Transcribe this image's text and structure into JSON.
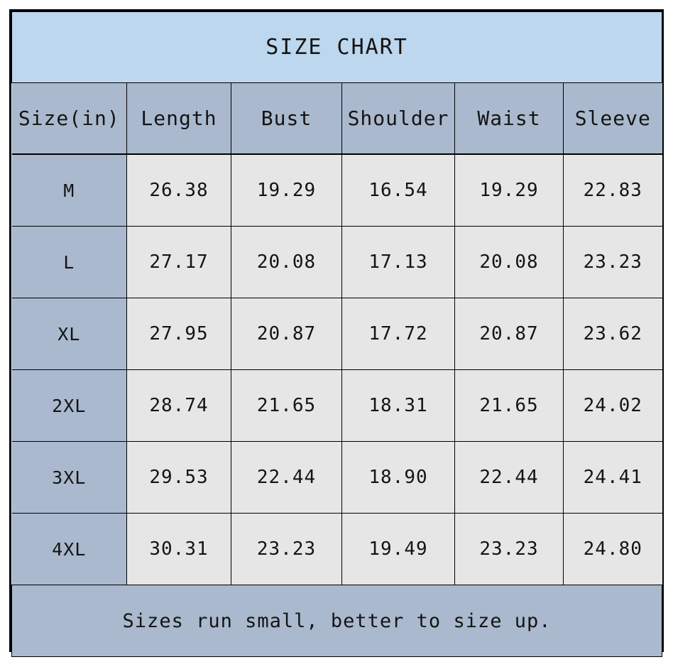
{
  "title": "SIZE CHART",
  "footer_note": "Sizes run small, better to size up.",
  "colors": {
    "title_background": "#bdd7ee",
    "header_background": "#aab9ce",
    "size_column_background": "#aab9ce",
    "data_cell_background": "#e6e6e6",
    "footer_background": "#aab9ce",
    "border": "#000000",
    "text": "#141414"
  },
  "chart_data": {
    "type": "table",
    "title": "SIZE CHART",
    "unit": "in",
    "columns": [
      "Size(in)",
      "Length",
      "Bust",
      "Shoulder",
      "Waist",
      "Sleeve"
    ],
    "rows": [
      {
        "size": "M",
        "length": "26.38",
        "bust": "19.29",
        "shoulder": "16.54",
        "waist": "19.29",
        "sleeve": "22.83"
      },
      {
        "size": "L",
        "length": "27.17",
        "bust": "20.08",
        "shoulder": "17.13",
        "waist": "20.08",
        "sleeve": "23.23"
      },
      {
        "size": "XL",
        "length": "27.95",
        "bust": "20.87",
        "shoulder": "17.72",
        "waist": "20.87",
        "sleeve": "23.62"
      },
      {
        "size": "2XL",
        "length": "28.74",
        "bust": "21.65",
        "shoulder": "18.31",
        "waist": "21.65",
        "sleeve": "24.02"
      },
      {
        "size": "3XL",
        "length": "29.53",
        "bust": "22.44",
        "shoulder": "18.90",
        "waist": "22.44",
        "sleeve": "24.41"
      },
      {
        "size": "4XL",
        "length": "30.31",
        "bust": "23.23",
        "shoulder": "19.49",
        "waist": "23.23",
        "sleeve": "24.80"
      }
    ],
    "note": "Sizes run small, better to size up."
  }
}
